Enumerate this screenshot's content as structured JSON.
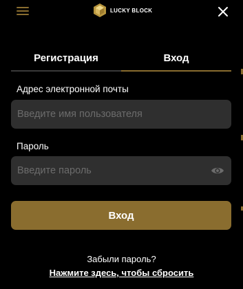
{
  "theme": {
    "accent": "#8a6d2f",
    "background": "#000000",
    "field_background": "#2f2f2f"
  },
  "header": {
    "logo_text": "LUCKY BLOCK",
    "menu_icon": "hamburger-menu-icon",
    "close_icon": "close-icon"
  },
  "tabs": [
    {
      "label": "Регистрация",
      "active": false
    },
    {
      "label": "Вход",
      "active": true
    }
  ],
  "form": {
    "email": {
      "label": "Адрес электронной почты",
      "placeholder": "Введите имя пользователя",
      "value": ""
    },
    "password": {
      "label": "Пароль",
      "placeholder": "Введите пароль",
      "value": "",
      "toggle_icon": "eye-icon"
    },
    "submit_label": "Вход"
  },
  "footer": {
    "forgot_text": "Забыли пароль?",
    "reset_link": "Нажмите здесь, чтобы сбросить"
  }
}
